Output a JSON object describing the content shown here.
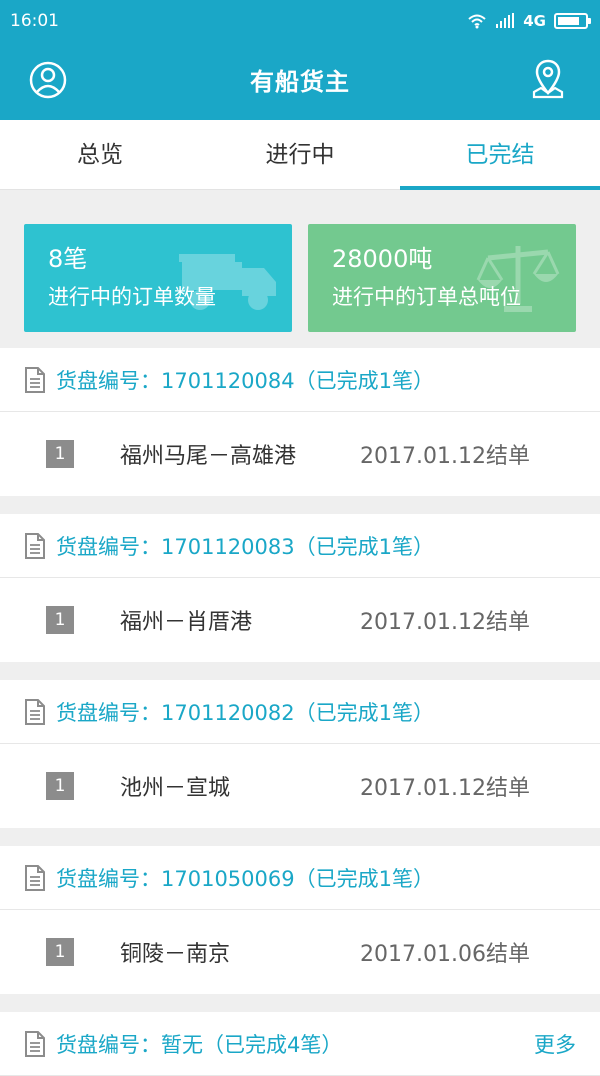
{
  "status_bar": {
    "time": "16:01",
    "network": "4G",
    "battery_level": 0.82
  },
  "header": {
    "title": "有船货主",
    "profile_icon": "user-circle-icon",
    "location_icon": "map-location-icon"
  },
  "tabs": [
    {
      "label": "总览"
    },
    {
      "label": "进行中"
    },
    {
      "label": "已完结"
    }
  ],
  "stats": [
    {
      "value": "8笔",
      "label": "进行中的订单数量",
      "icon": "truck-icon",
      "color": "#2ec2d0"
    },
    {
      "value": "28000吨",
      "label": "进行中的订单总吨位",
      "icon": "scale-icon",
      "color": "#73c98f"
    }
  ],
  "order_groups": [
    {
      "header": "货盘编号：1701120084（已完成1笔）",
      "rows": [
        {
          "index": "1",
          "route": "福州马尾－高雄港",
          "date": "2017.01.12结单"
        }
      ]
    },
    {
      "header": "货盘编号：1701120083（已完成1笔）",
      "rows": [
        {
          "index": "1",
          "route": "福州－肖厝港",
          "date": "2017.01.12结单"
        }
      ]
    },
    {
      "header": "货盘编号：1701120082（已完成1笔）",
      "rows": [
        {
          "index": "1",
          "route": "池州－宣城",
          "date": "2017.01.12结单"
        }
      ]
    },
    {
      "header": "货盘编号：1701050069（已完成1笔）",
      "rows": [
        {
          "index": "1",
          "route": "铜陵－南京",
          "date": "2017.01.06结单"
        }
      ]
    }
  ],
  "last_group": {
    "header": "货盘编号：暂无（已完成4笔）",
    "more_label": "更多"
  },
  "theme": {
    "primary": "#1aa7c7",
    "background": "#efefef"
  }
}
